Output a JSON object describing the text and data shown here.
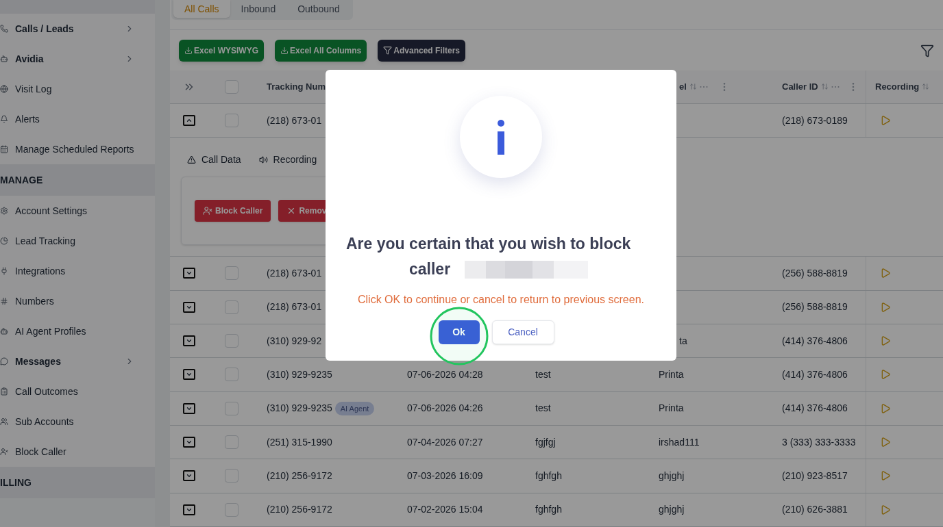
{
  "sidebar": {
    "groups": [
      {
        "items": [
          {
            "label": "Calls / Leads",
            "kind": "group"
          },
          {
            "label": "Avidia",
            "kind": "group"
          },
          {
            "label": "Visit Log",
            "kind": "link"
          },
          {
            "label": "Alerts",
            "kind": "link"
          },
          {
            "label": "Manage Scheduled Reports",
            "kind": "link"
          }
        ]
      },
      {
        "title": "MANAGE",
        "items": [
          {
            "label": "Account Settings",
            "kind": "link"
          },
          {
            "label": "Lead Tracking",
            "kind": "link"
          },
          {
            "label": "Integrations",
            "kind": "link"
          },
          {
            "label": "Numbers",
            "kind": "link"
          },
          {
            "label": "AI Agent Profiles",
            "kind": "link"
          },
          {
            "label": "Messages",
            "kind": "group"
          },
          {
            "label": "Call Outcomes",
            "kind": "link"
          },
          {
            "label": "Sub Accounts",
            "kind": "link"
          },
          {
            "label": "Block Caller",
            "kind": "link"
          }
        ]
      },
      {
        "title": "ILLING"
      }
    ]
  },
  "tabs": [
    {
      "label": "All Calls",
      "selected": true
    },
    {
      "label": "Inbound",
      "selected": false
    },
    {
      "label": "Outbound",
      "selected": false
    }
  ],
  "toolbar": [
    {
      "label": "Excel WYSIWYG",
      "kind": "export"
    },
    {
      "label": "Excel All Columns",
      "kind": "export"
    },
    {
      "label": "Advanced Filters",
      "kind": "filter"
    }
  ],
  "table": {
    "header": {
      "checked": false,
      "tracking": "Tracking Num",
      "column_4": "el",
      "caller_id": "Caller ID",
      "recording": "Recording"
    },
    "rows": [
      {
        "kind": "covered",
        "expanded": true,
        "checked": false,
        "tracking": "(218) 673-01",
        "caller_id": "(218) 673-0189"
      },
      {
        "kind": "covered",
        "expanded": false,
        "checked": false,
        "tracking": "(218) 673-01",
        "caller_id": "(256) 588-8819"
      },
      {
        "kind": "covered",
        "expanded": false,
        "checked": false,
        "tracking": "(218) 673-01",
        "caller_id": "(256) 588-8819"
      },
      {
        "kind": "covered",
        "expanded": false,
        "checked": false,
        "tracking": "(310) 929-92",
        "column_4": "ta",
        "caller_id": "(414) 376-4806"
      },
      {
        "kind": "full",
        "expanded": false,
        "checked": false,
        "tracking": "(310) 929-9235",
        "date": "07-06-2026 04:28",
        "column_3": "test",
        "column_4": "Printa",
        "caller_id": "(414) 376-4806"
      },
      {
        "kind": "full",
        "expanded": false,
        "checked": false,
        "tracking": "(310) 929-9235",
        "badge": "AI Agent",
        "date": "07-06-2026 04:26",
        "column_3": "test",
        "column_4": "Printa",
        "caller_id": "(414) 376-4806"
      },
      {
        "kind": "full",
        "expanded": false,
        "checked": false,
        "tracking": "(251) 315-1990",
        "date": "07-04-2026 07:27",
        "column_3": "fgjfgj",
        "column_4": "irshad111",
        "caller_id": "3 (333) 333-3333"
      },
      {
        "kind": "full",
        "expanded": false,
        "checked": false,
        "tracking": "(210) 256-9172",
        "date": "07-03-2026 16:09",
        "column_3": "fghfgh",
        "column_4": "ghjghj",
        "caller_id": "(210) 923-8517"
      },
      {
        "kind": "full",
        "expanded": false,
        "checked": false,
        "tracking": "(210) 256-9172",
        "date": "07-02-2026 15:04",
        "column_3": "fghfgh",
        "column_4": "ghjghj",
        "caller_id": "(210) 626-3881"
      }
    ]
  },
  "expanded_panel": {
    "tabs": [
      {
        "label": "Call Data",
        "kind": "data"
      },
      {
        "label": "Recording",
        "kind": "recording"
      }
    ],
    "actions": [
      {
        "label": "Block Caller",
        "kind": "block"
      },
      {
        "label": "Remov",
        "kind": "remove"
      }
    ]
  },
  "dialog": {
    "title": "Are you certain that you wish to block caller",
    "message": "Click OK to continue or cancel to return to previous screen.",
    "buttons": [
      {
        "label": "Ok",
        "kind": "primary"
      },
      {
        "label": "Cancel",
        "kind": "secondary"
      }
    ]
  }
}
